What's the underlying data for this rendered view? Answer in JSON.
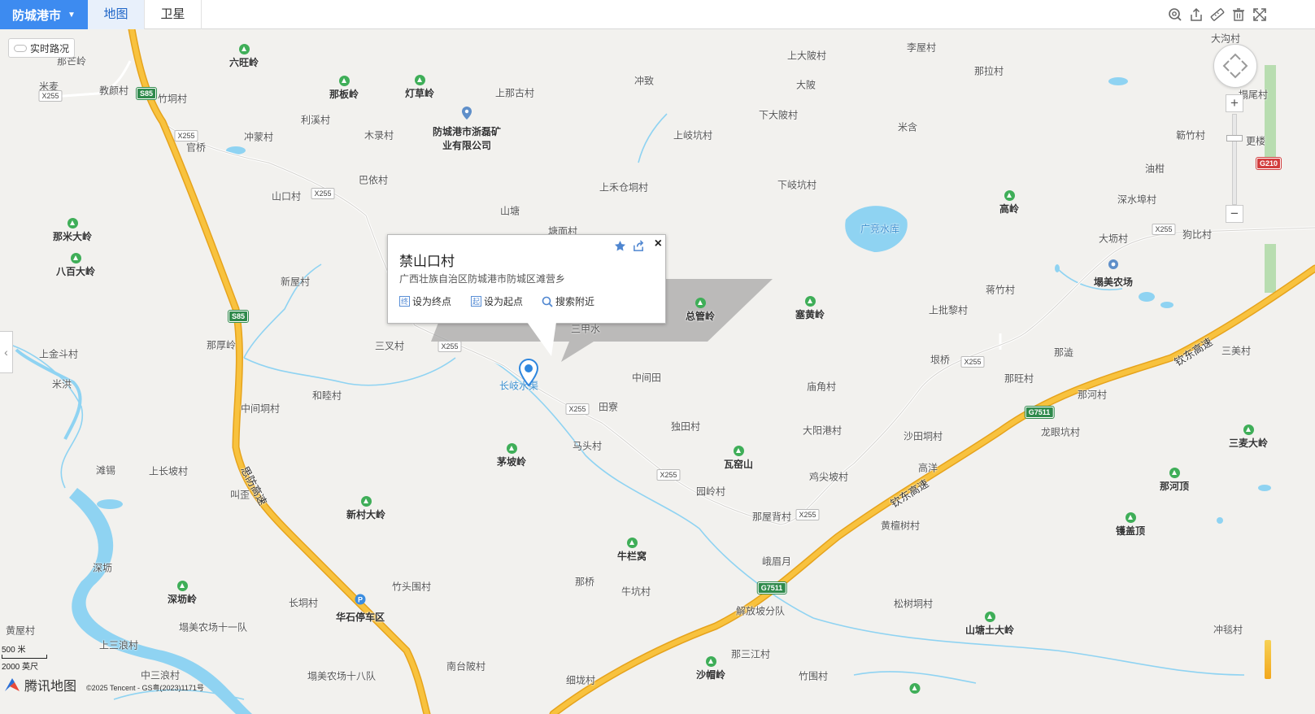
{
  "header": {
    "city": "防城港市",
    "tabs": [
      {
        "label": "地图",
        "active": true
      },
      {
        "label": "卫星",
        "active": false
      }
    ],
    "tools": [
      "search-ring-icon",
      "share-icon",
      "ruler-icon",
      "clear-icon",
      "fullscreen-icon"
    ]
  },
  "traffic_button": "实时路况",
  "popup": {
    "title": "禁山口村",
    "address": "广西壮族自治区防城港市防城区滩营乡",
    "actions": [
      {
        "icon": "终",
        "label": "设为终点"
      },
      {
        "icon": "起",
        "label": "设为起点"
      },
      {
        "icon": "search",
        "label": "搜索附近"
      }
    ],
    "close": "×"
  },
  "marker_label": "长岐水渠",
  "map_labels": [
    "那芒岭",
    "米麦",
    "X255",
    "教颜村",
    "竹垌村",
    "六旺岭",
    "那板岭",
    "灯草岭",
    "上那古村",
    "冲致",
    "上大陂村",
    "李屋村",
    "那拉村",
    "大沟村",
    "塌尾村",
    "利溪村",
    "冲蒙村",
    "官桥",
    "木录村",
    "防城港市浙磊矿业有限公司",
    "上岐坑村",
    "大陂",
    "下大陂村",
    "米含",
    "簕竹村",
    "更楼",
    "油柑",
    "巴依村",
    "山口村",
    "上禾仓垌村",
    "下岐坑村",
    "广竞水库",
    "深水埠村",
    "高岭",
    "山塘",
    "塘面村",
    "大坜村",
    "狗比村",
    "那米大岭",
    "八百大岭",
    "新屋村",
    "总管岭",
    "塞黄岭",
    "蒋竹村",
    "塌美农场",
    "上批黎村",
    "三甲水",
    "那厚岭",
    "三叉村",
    "上金斗村",
    "米洪",
    "长岐水渠",
    "中间田",
    "垠桥",
    "庙角村",
    "那澁",
    "那旺村",
    "三美村",
    "和睦村",
    "中间垌村",
    "田寮",
    "那河村",
    "独田村",
    "大阳港村",
    "沙田垌村",
    "龙眼坑村",
    "三麦大岭",
    "滩锡",
    "上长坡村",
    "茅坡岭",
    "马头村",
    "瓦窑山",
    "高洋",
    "鸡尖坡村",
    "那河顶",
    "叫歪",
    "新村大岭",
    "园岭村",
    "那屋背村",
    "镬盖顶",
    "黄檀树村",
    "深坜岭",
    "牛栏窝",
    "峨眉月",
    "深坜",
    "长垌村",
    "竹头围村",
    "那桥",
    "牛坑村",
    "解放坡分队",
    "松树垌村",
    "山塘土大岭",
    "冲毯村",
    "黄屋村",
    "塌美农场十一队",
    "华石停车区",
    "上三浪村",
    "那三江村",
    "中三浪村",
    "塌美农场十八队",
    "南台陂村",
    "细垅村",
    "沙帽岭",
    "竹围村"
  ],
  "road_shields": [
    "S85",
    "X255",
    "G7511",
    "G210"
  ],
  "highway_names": [
    "思防高速",
    "钦东高速"
  ],
  "zoom": {
    "plus": "+",
    "minus": "−"
  },
  "scale": {
    "metric": "500 米",
    "imperial": "2000 英尺"
  },
  "logo_text": "腾讯地图",
  "copyright": "©2025 Tencent - GS粤(2023)1171号",
  "colors": {
    "accent": "#3d8bf0",
    "highway": "#f6b830",
    "water": "#6ec6ee",
    "park": "#3fae58",
    "land": "#f2f1ee"
  }
}
